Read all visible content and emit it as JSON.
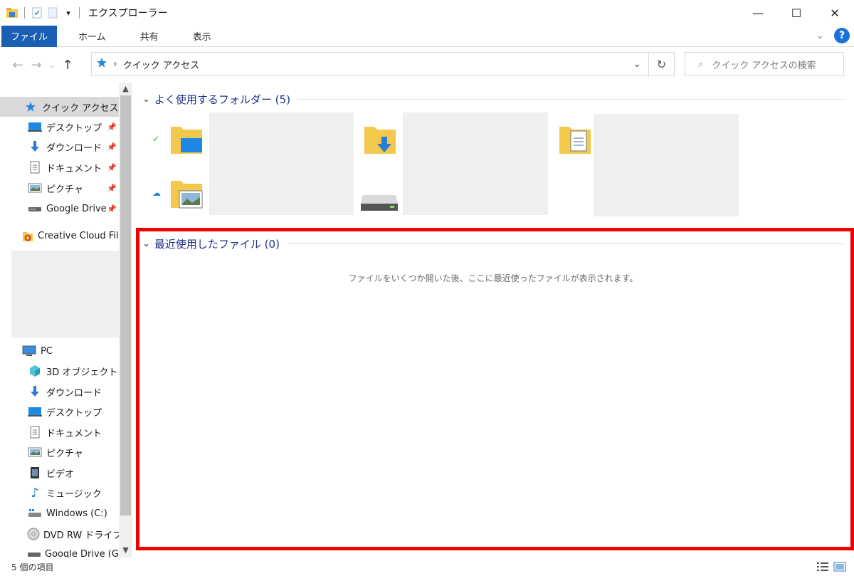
{
  "window": {
    "title": "エクスプローラー"
  },
  "ribbon": {
    "tabs": [
      "ファイル",
      "ホーム",
      "共有",
      "表示"
    ]
  },
  "address": {
    "crumb": "クイック アクセス"
  },
  "search": {
    "placeholder": "クイック アクセスの検索"
  },
  "nav": {
    "quick_access": "クイック アクセス",
    "qa_items": [
      "デスクトップ",
      "ダウンロード",
      "ドキュメント",
      "ピクチャ",
      "Google Drive"
    ],
    "creative_cloud": "Creative Cloud Files",
    "pc": "PC",
    "pc_items": [
      "3D オブジェクト",
      "ダウンロード",
      "デスクトップ",
      "ドキュメント",
      "ピクチャ",
      "ビデオ",
      "ミュージック",
      "Windows (C:)",
      "DVD RW ドライブ (",
      "Google Drive (G:"
    ]
  },
  "content": {
    "frequent_header": "よく使用するフォルダー (5)",
    "recent_header": "最近使用したファイル (0)",
    "recent_empty": "ファイルをいくつか開いた後、ここに最近使ったファイルが表示されます。"
  },
  "status": {
    "item_count": "5 個の項目"
  },
  "colors": {
    "accent": "#1a5fb4",
    "highlight": "#ee0000",
    "group_header": "#1e3287"
  }
}
